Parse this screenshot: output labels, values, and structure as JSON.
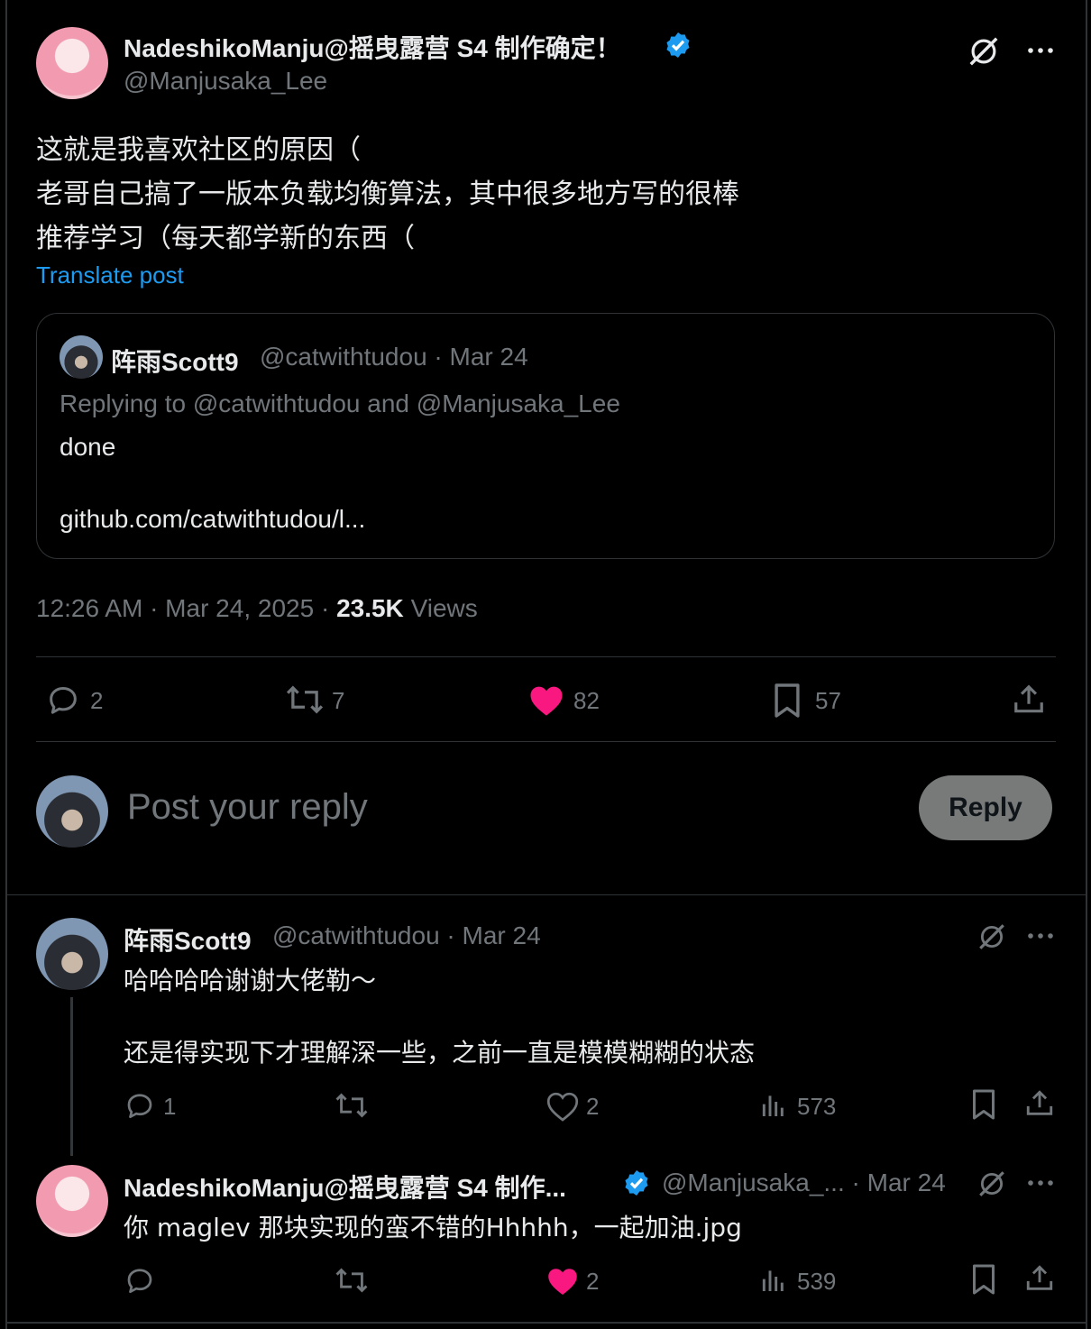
{
  "main_post": {
    "display_name": "NadeshikoManju@摇曳露营 S4 制作确定！",
    "handle": "@Manjusaka_Lee",
    "text_lines": [
      "这就是我喜欢社区的原因（",
      "老哥自己搞了一版本负载均衡算法，其中很多地方写的很棒",
      "推荐学习（每天都学新的东西（"
    ],
    "translate": "Translate post",
    "timestamp": "12:26 AM · Mar 24, 2025 · ",
    "views_count": "23.5K",
    "views_label": "Views",
    "replies": "2",
    "reposts": "7",
    "likes": "82",
    "bookmarks": "57"
  },
  "quoted": {
    "display_name": "阵雨Scott9",
    "handle_date": "@catwithtudou · Mar 24",
    "replying_to": "Replying to @catwithtudou and @Manjusaka_Lee",
    "text": "done",
    "link": "github.com/catwithtudou/l..."
  },
  "composer": {
    "placeholder": "Post your reply",
    "button": "Reply"
  },
  "reply1": {
    "display_name": "阵雨Scott9",
    "handle_date": "@catwithtudou · Mar 24",
    "line1": "哈哈哈哈谢谢大佬勒～",
    "line2": "还是得实现下才理解深一些，之前一直是模模糊糊的状态",
    "replies": "1",
    "likes": "2",
    "views": "573"
  },
  "reply2": {
    "display_name": "NadeshikoManju@摇曳露营 S4 制作...",
    "handle_date": "@Manjusaka_... · Mar 24",
    "text": "你 maglev 那块实现的蛮不错的Hhhhh，一起加油.jpg",
    "likes": "2",
    "views": "539"
  },
  "icons": [
    "grok-icon",
    "more-icon",
    "verified-badge-icon",
    "reply-icon",
    "repost-icon",
    "like-icon",
    "bookmark-icon",
    "share-icon",
    "views-icon"
  ],
  "colors": {
    "accent": "#1d9bf0",
    "like": "#f91880",
    "muted": "#71767b",
    "text": "#e7e9ea"
  }
}
